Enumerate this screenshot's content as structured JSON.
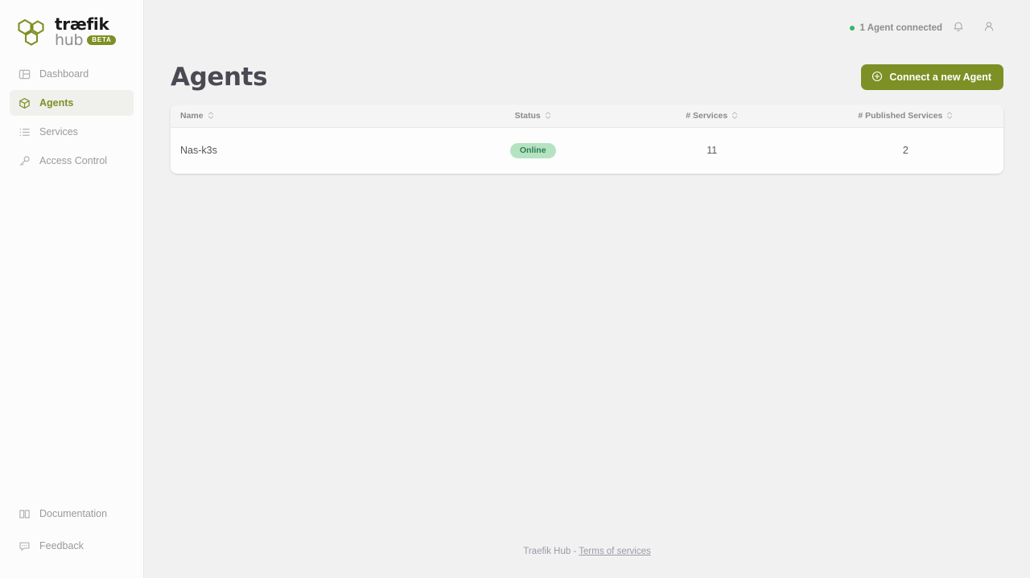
{
  "brand": {
    "name_line1": "træfik",
    "name_line2": "hub",
    "badge": "BETA",
    "accent_color": "#7d9025"
  },
  "sidebar": {
    "items": [
      {
        "label": "Dashboard",
        "icon": "layout-icon",
        "active": false
      },
      {
        "label": "Agents",
        "icon": "cube-icon",
        "active": true
      },
      {
        "label": "Services",
        "icon": "list-icon",
        "active": false
      },
      {
        "label": "Access Control",
        "icon": "key-icon",
        "active": false
      }
    ],
    "bottom_items": [
      {
        "label": "Documentation",
        "icon": "book-icon"
      },
      {
        "label": "Feedback",
        "icon": "chat-icon"
      }
    ]
  },
  "topbar": {
    "status_text": "1 Agent connected",
    "status_dot_color": "#34b864",
    "notifications_icon": "bell-icon",
    "account_icon": "user-icon"
  },
  "page": {
    "title": "Agents",
    "primary_action": "Connect a new Agent",
    "primary_action_icon": "plus-circle-icon"
  },
  "table": {
    "columns": [
      {
        "label": "Name",
        "align": "left"
      },
      {
        "label": "Status",
        "align": "center"
      },
      {
        "label": "# Services",
        "align": "center"
      },
      {
        "label": "# Published Services",
        "align": "center"
      }
    ],
    "rows": [
      {
        "name": "Nas-k3s",
        "status": "Online",
        "status_bg": "#b5e3c1",
        "status_fg": "#2e7d52",
        "services": "11",
        "published_services": "2"
      }
    ]
  },
  "footer": {
    "text": "Traefik Hub - ",
    "link": "Terms of services"
  }
}
